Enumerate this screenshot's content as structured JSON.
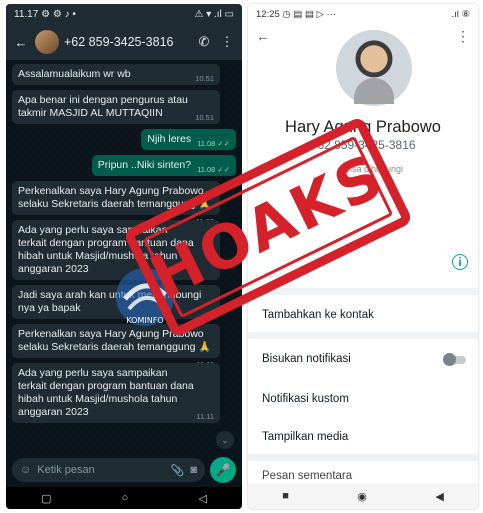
{
  "left": {
    "status": {
      "time": "11.17",
      "indicators": "⚙ ⚙ ♪ •",
      "right": "⚠ ▾ .ıl ▭"
    },
    "header": {
      "contact": "+62 859-3425-3816",
      "back_icon": "arrow-left-icon",
      "call_icon": "call-add-icon",
      "menu_icon": "more-vert-icon"
    },
    "messages": [
      {
        "dir": "in",
        "text": "Assalamualaikum wr wb",
        "time": "10.51"
      },
      {
        "dir": "in",
        "text": "Apa benar ini dengan pengurus atau takmir MASJID AL MUTTAQIIN",
        "time": "10.51"
      },
      {
        "dir": "out",
        "text": "Njih leres",
        "time": "11.08 ✓✓"
      },
      {
        "dir": "out",
        "text": "Pripun ..Niki sinten?",
        "time": "11.08 ✓✓"
      },
      {
        "dir": "in",
        "text": "Perkenalkan saya Hary Agung Prabowo selaku Sekretaris daerah temanggung 🙏",
        "time": "11.08"
      },
      {
        "dir": "in",
        "text": "Ada yang perlu saya sampaikan terkait dengan program bantuan dana hibah untuk Masjid/mushola tahun anggaran 2023",
        "time": ""
      },
      {
        "dir": "in",
        "text": "Jadi saya arah kan untuk menghubungi nya ya bapak",
        "time": ""
      },
      {
        "dir": "in",
        "text": "Perkenalkan saya Hary Agung Prabowo selaku Sekretaris daerah temanggung 🙏",
        "time": "11.11"
      },
      {
        "dir": "in",
        "text": "Ada yang perlu saya sampaikan terkait dengan program bantuan dana hibah untuk Masjid/mushola tahun anggaran 2023",
        "time": "11.11"
      }
    ],
    "composer": {
      "placeholder": "Ketik pesan",
      "emoji_icon": "emoji-icon",
      "attach_icon": "attach-icon",
      "camera_icon": "camera-icon",
      "mic_icon": "mic-icon"
    },
    "nav": [
      "▢",
      "○",
      "◁"
    ]
  },
  "right": {
    "status": {
      "time": "12:25",
      "indicators": "◷ ▤ ▤ ▷ ···",
      "right": ".ıl ⑧"
    },
    "name": "Hary Agung Prabowo",
    "phone": "+62 859-3425-3816",
    "about_label": "Bisa dihubungi",
    "rows": {
      "add_contact": "Tambahkan ke kontak",
      "mute": "Bisukan notifikasi",
      "custom_notif": "Notifikasi kustom",
      "media": "Tampilkan media",
      "disappearing": "Pesan sementara"
    },
    "nav": [
      "■",
      "◉",
      "◀"
    ]
  },
  "overlay": {
    "stamp_text": "HOAKS",
    "stamp_color": "#d4212a",
    "logo_text": "KOMINFO"
  }
}
